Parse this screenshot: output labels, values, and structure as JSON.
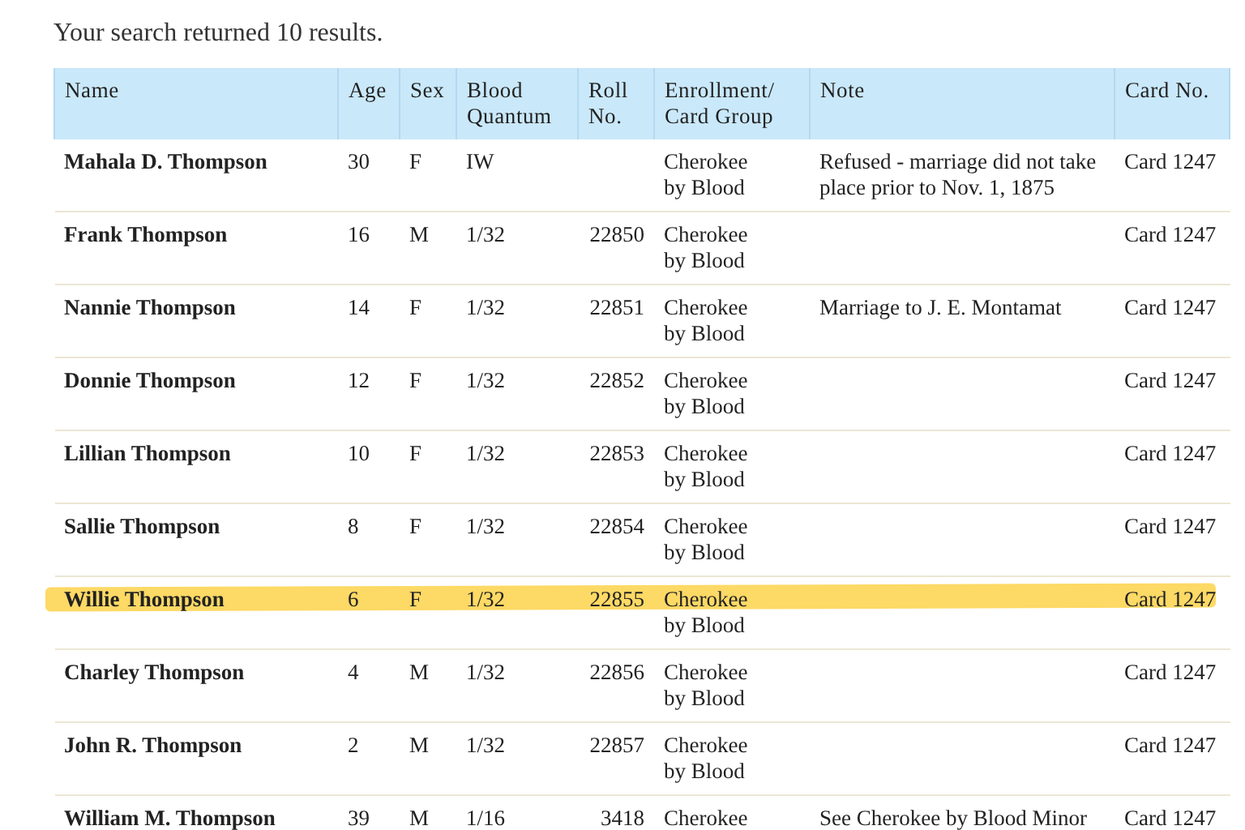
{
  "summary": "Your search returned 10 results.",
  "table": {
    "columns": [
      "Name",
      "Age",
      "Sex",
      "Blood Quantum",
      "Roll No.",
      "Enrollment/ Card Group",
      "Note",
      "Card No."
    ],
    "rows": [
      {
        "cells": [
          "Mahala D. Thompson",
          "30",
          "F",
          "IW",
          "",
          "Cherokee by Blood",
          "Refused - marriage did not take place prior to Nov. 1, 1875",
          "Card 1247"
        ],
        "highlighted": false
      },
      {
        "cells": [
          "Frank Thompson",
          "16",
          "M",
          "1/32",
          "22850",
          "Cherokee by Blood",
          "",
          "Card 1247"
        ],
        "highlighted": false
      },
      {
        "cells": [
          "Nannie Thompson",
          "14",
          "F",
          "1/32",
          "22851",
          "Cherokee by Blood",
          "Marriage to J. E. Montamat",
          "Card 1247"
        ],
        "highlighted": false
      },
      {
        "cells": [
          "Donnie Thompson",
          "12",
          "F",
          "1/32",
          "22852",
          "Cherokee by Blood",
          "",
          "Card 1247"
        ],
        "highlighted": false
      },
      {
        "cells": [
          "Lillian Thompson",
          "10",
          "F",
          "1/32",
          "22853",
          "Cherokee by Blood",
          "",
          "Card 1247"
        ],
        "highlighted": false
      },
      {
        "cells": [
          "Sallie Thompson",
          "8",
          "F",
          "1/32",
          "22854",
          "Cherokee by Blood",
          "",
          "Card 1247"
        ],
        "highlighted": false
      },
      {
        "cells": [
          "Willie Thompson",
          "6",
          "F",
          "1/32",
          "22855",
          "Cherokee by Blood",
          "",
          "Card 1247"
        ],
        "highlighted": true
      },
      {
        "cells": [
          "Charley Thompson",
          "4",
          "M",
          "1/32",
          "22856",
          "Cherokee by Blood",
          "",
          "Card 1247"
        ],
        "highlighted": false
      },
      {
        "cells": [
          "John R. Thompson",
          "2",
          "M",
          "1/32",
          "22857",
          "Cherokee by Blood",
          "",
          "Card 1247"
        ],
        "highlighted": false
      },
      {
        "cells": [
          "William M. Thompson",
          "39",
          "M",
          "1/16",
          "3418",
          "Cherokee",
          "See Cherokee by Blood Minor",
          "Card 1247"
        ],
        "highlighted": false
      }
    ]
  }
}
